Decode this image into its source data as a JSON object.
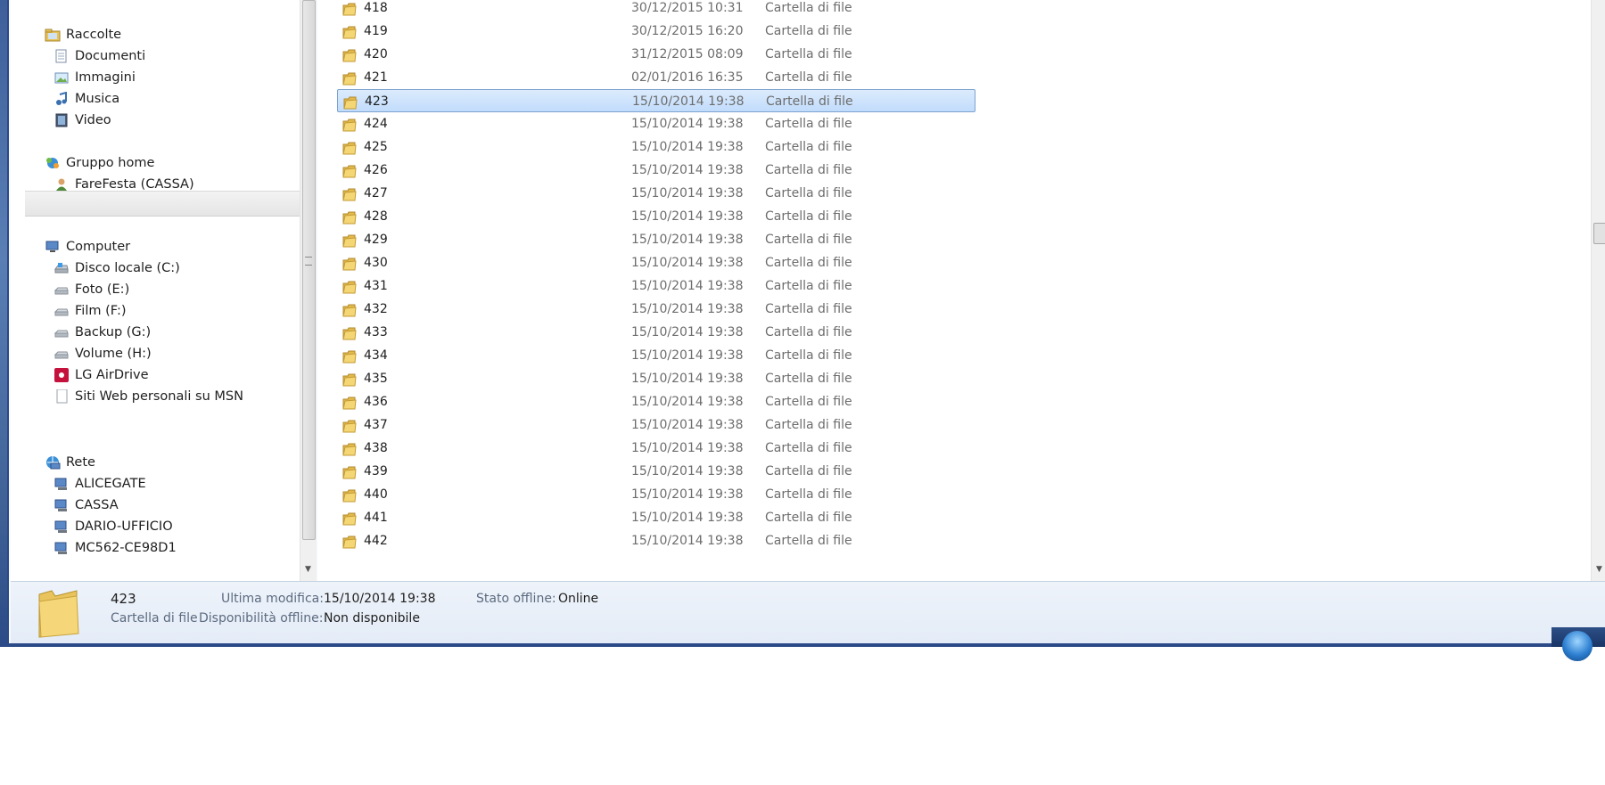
{
  "nav": {
    "libraries": {
      "label": "Raccolte",
      "items": [
        "Documenti",
        "Immagini",
        "Musica",
        "Video"
      ]
    },
    "homegroup": {
      "label": "Gruppo home",
      "items": [
        "FareFesta (CASSA)"
      ]
    },
    "computer": {
      "label": "Computer",
      "items": [
        "Disco locale (C:)",
        "Foto (E:)",
        "Film (F:)",
        "Backup (G:)",
        "Volume (H:)",
        "LG AirDrive",
        "Siti Web personali su MSN"
      ]
    },
    "network": {
      "label": "Rete",
      "items": [
        "ALICEGATE",
        "CASSA",
        "DARIO-UFFICIO",
        "MC562-CE98D1"
      ]
    }
  },
  "files": [
    {
      "name": "418",
      "date": "30/12/2015 10:31",
      "type": "Cartella di file"
    },
    {
      "name": "419",
      "date": "30/12/2015 16:20",
      "type": "Cartella di file"
    },
    {
      "name": "420",
      "date": "31/12/2015 08:09",
      "type": "Cartella di file"
    },
    {
      "name": "421",
      "date": "02/01/2016 16:35",
      "type": "Cartella di file"
    },
    {
      "name": "423",
      "date": "15/10/2014 19:38",
      "type": "Cartella di file"
    },
    {
      "name": "424",
      "date": "15/10/2014 19:38",
      "type": "Cartella di file"
    },
    {
      "name": "425",
      "date": "15/10/2014 19:38",
      "type": "Cartella di file"
    },
    {
      "name": "426",
      "date": "15/10/2014 19:38",
      "type": "Cartella di file"
    },
    {
      "name": "427",
      "date": "15/10/2014 19:38",
      "type": "Cartella di file"
    },
    {
      "name": "428",
      "date": "15/10/2014 19:38",
      "type": "Cartella di file"
    },
    {
      "name": "429",
      "date": "15/10/2014 19:38",
      "type": "Cartella di file"
    },
    {
      "name": "430",
      "date": "15/10/2014 19:38",
      "type": "Cartella di file"
    },
    {
      "name": "431",
      "date": "15/10/2014 19:38",
      "type": "Cartella di file"
    },
    {
      "name": "432",
      "date": "15/10/2014 19:38",
      "type": "Cartella di file"
    },
    {
      "name": "433",
      "date": "15/10/2014 19:38",
      "type": "Cartella di file"
    },
    {
      "name": "434",
      "date": "15/10/2014 19:38",
      "type": "Cartella di file"
    },
    {
      "name": "435",
      "date": "15/10/2014 19:38",
      "type": "Cartella di file"
    },
    {
      "name": "436",
      "date": "15/10/2014 19:38",
      "type": "Cartella di file"
    },
    {
      "name": "437",
      "date": "15/10/2014 19:38",
      "type": "Cartella di file"
    },
    {
      "name": "438",
      "date": "15/10/2014 19:38",
      "type": "Cartella di file"
    },
    {
      "name": "439",
      "date": "15/10/2014 19:38",
      "type": "Cartella di file"
    },
    {
      "name": "440",
      "date": "15/10/2014 19:38",
      "type": "Cartella di file"
    },
    {
      "name": "441",
      "date": "15/10/2014 19:38",
      "type": "Cartella di file"
    },
    {
      "name": "442",
      "date": "15/10/2014 19:38",
      "type": "Cartella di file"
    }
  ],
  "selected_file": "423",
  "details": {
    "name": "423",
    "type": "Cartella di file",
    "modified_label": "Ultima modifica:",
    "modified_value": "15/10/2014 19:38",
    "offline_avail_label": "Disponibilità offline:",
    "offline_avail_value": "Non disponibile",
    "offline_state_label": "Stato offline:",
    "offline_state_value": "Online"
  },
  "colors": {
    "selection": "#cce4fc",
    "selection_border": "#7da2ce",
    "folder": "#e8c25a"
  }
}
